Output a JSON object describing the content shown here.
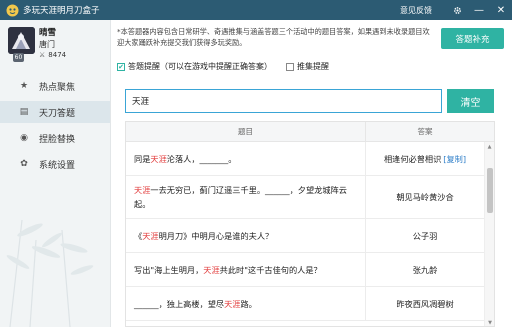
{
  "titlebar": {
    "title": "多玩天涯明月刀盒子",
    "feedback": "意见反馈",
    "settings_icon": "gear-icon",
    "minimize": "—",
    "close": "✕"
  },
  "user": {
    "name": "晴雪",
    "sect": "唐门",
    "level": "60",
    "power": "8474",
    "power_icon": "⚔"
  },
  "nav": [
    {
      "label": "热点聚焦",
      "icon": "★",
      "active": false
    },
    {
      "label": "天刀答题",
      "icon": "▤",
      "active": true
    },
    {
      "label": "捏脸替换",
      "icon": "◉",
      "active": false
    },
    {
      "label": "系统设置",
      "icon": "✿",
      "active": false
    }
  ],
  "notice": "*本答题器内容包含日常研学、奇遇推集与涵盖答题三个活动中的题目答案，如果遇到未收录题目欢迎大家踊跃补充提交我们获得多玩奖励。",
  "supplement_button": "答题补充",
  "checks": [
    {
      "label": "答题提醒（可以在游戏中提醒正确答案）",
      "checked": true,
      "mark": "✔"
    },
    {
      "label": "推集提醒",
      "checked": false,
      "mark": ""
    }
  ],
  "search": {
    "value": "天涯"
  },
  "clear_button": "清空",
  "table": {
    "headers": {
      "question": "题目",
      "answer": "答案"
    },
    "copy_label": "[复制]",
    "rows": [
      {
        "q": [
          {
            "t": "同是"
          },
          {
            "t": "天涯",
            "hl": true
          },
          {
            "t": "沦落人，_______。"
          }
        ],
        "a": "相逢何必曾相识",
        "copy": true
      },
      {
        "q": [
          {
            "t": "天涯",
            "hl": true
          },
          {
            "t": "一去无穷已，蓟门辽遥三千里。______，夕望龙城阵云起。"
          }
        ],
        "a": "朝见马岭黄沙合",
        "copy": false
      },
      {
        "q": [
          {
            "t": "《"
          },
          {
            "t": "天涯",
            "hl": true
          },
          {
            "t": "明月刀》中明月心是谁的夫人？"
          }
        ],
        "a": "公子羽",
        "copy": false
      },
      {
        "q": [
          {
            "t": "写出\"海上生明月，"
          },
          {
            "t": "天涯",
            "hl": true
          },
          {
            "t": "共此时\"这千古佳句的人是？"
          }
        ],
        "a": "张九龄",
        "copy": false
      },
      {
        "q": [
          {
            "t": "______，独上高楼，望尽"
          },
          {
            "t": "天涯",
            "hl": true
          },
          {
            "t": "路。"
          }
        ],
        "a": "昨夜西风凋碧树",
        "copy": false
      }
    ]
  },
  "colors": {
    "titlebar": "#2c5b73",
    "accent": "#2fb3a3",
    "highlight": "#e23d3d",
    "link": "#2f7fc9"
  }
}
